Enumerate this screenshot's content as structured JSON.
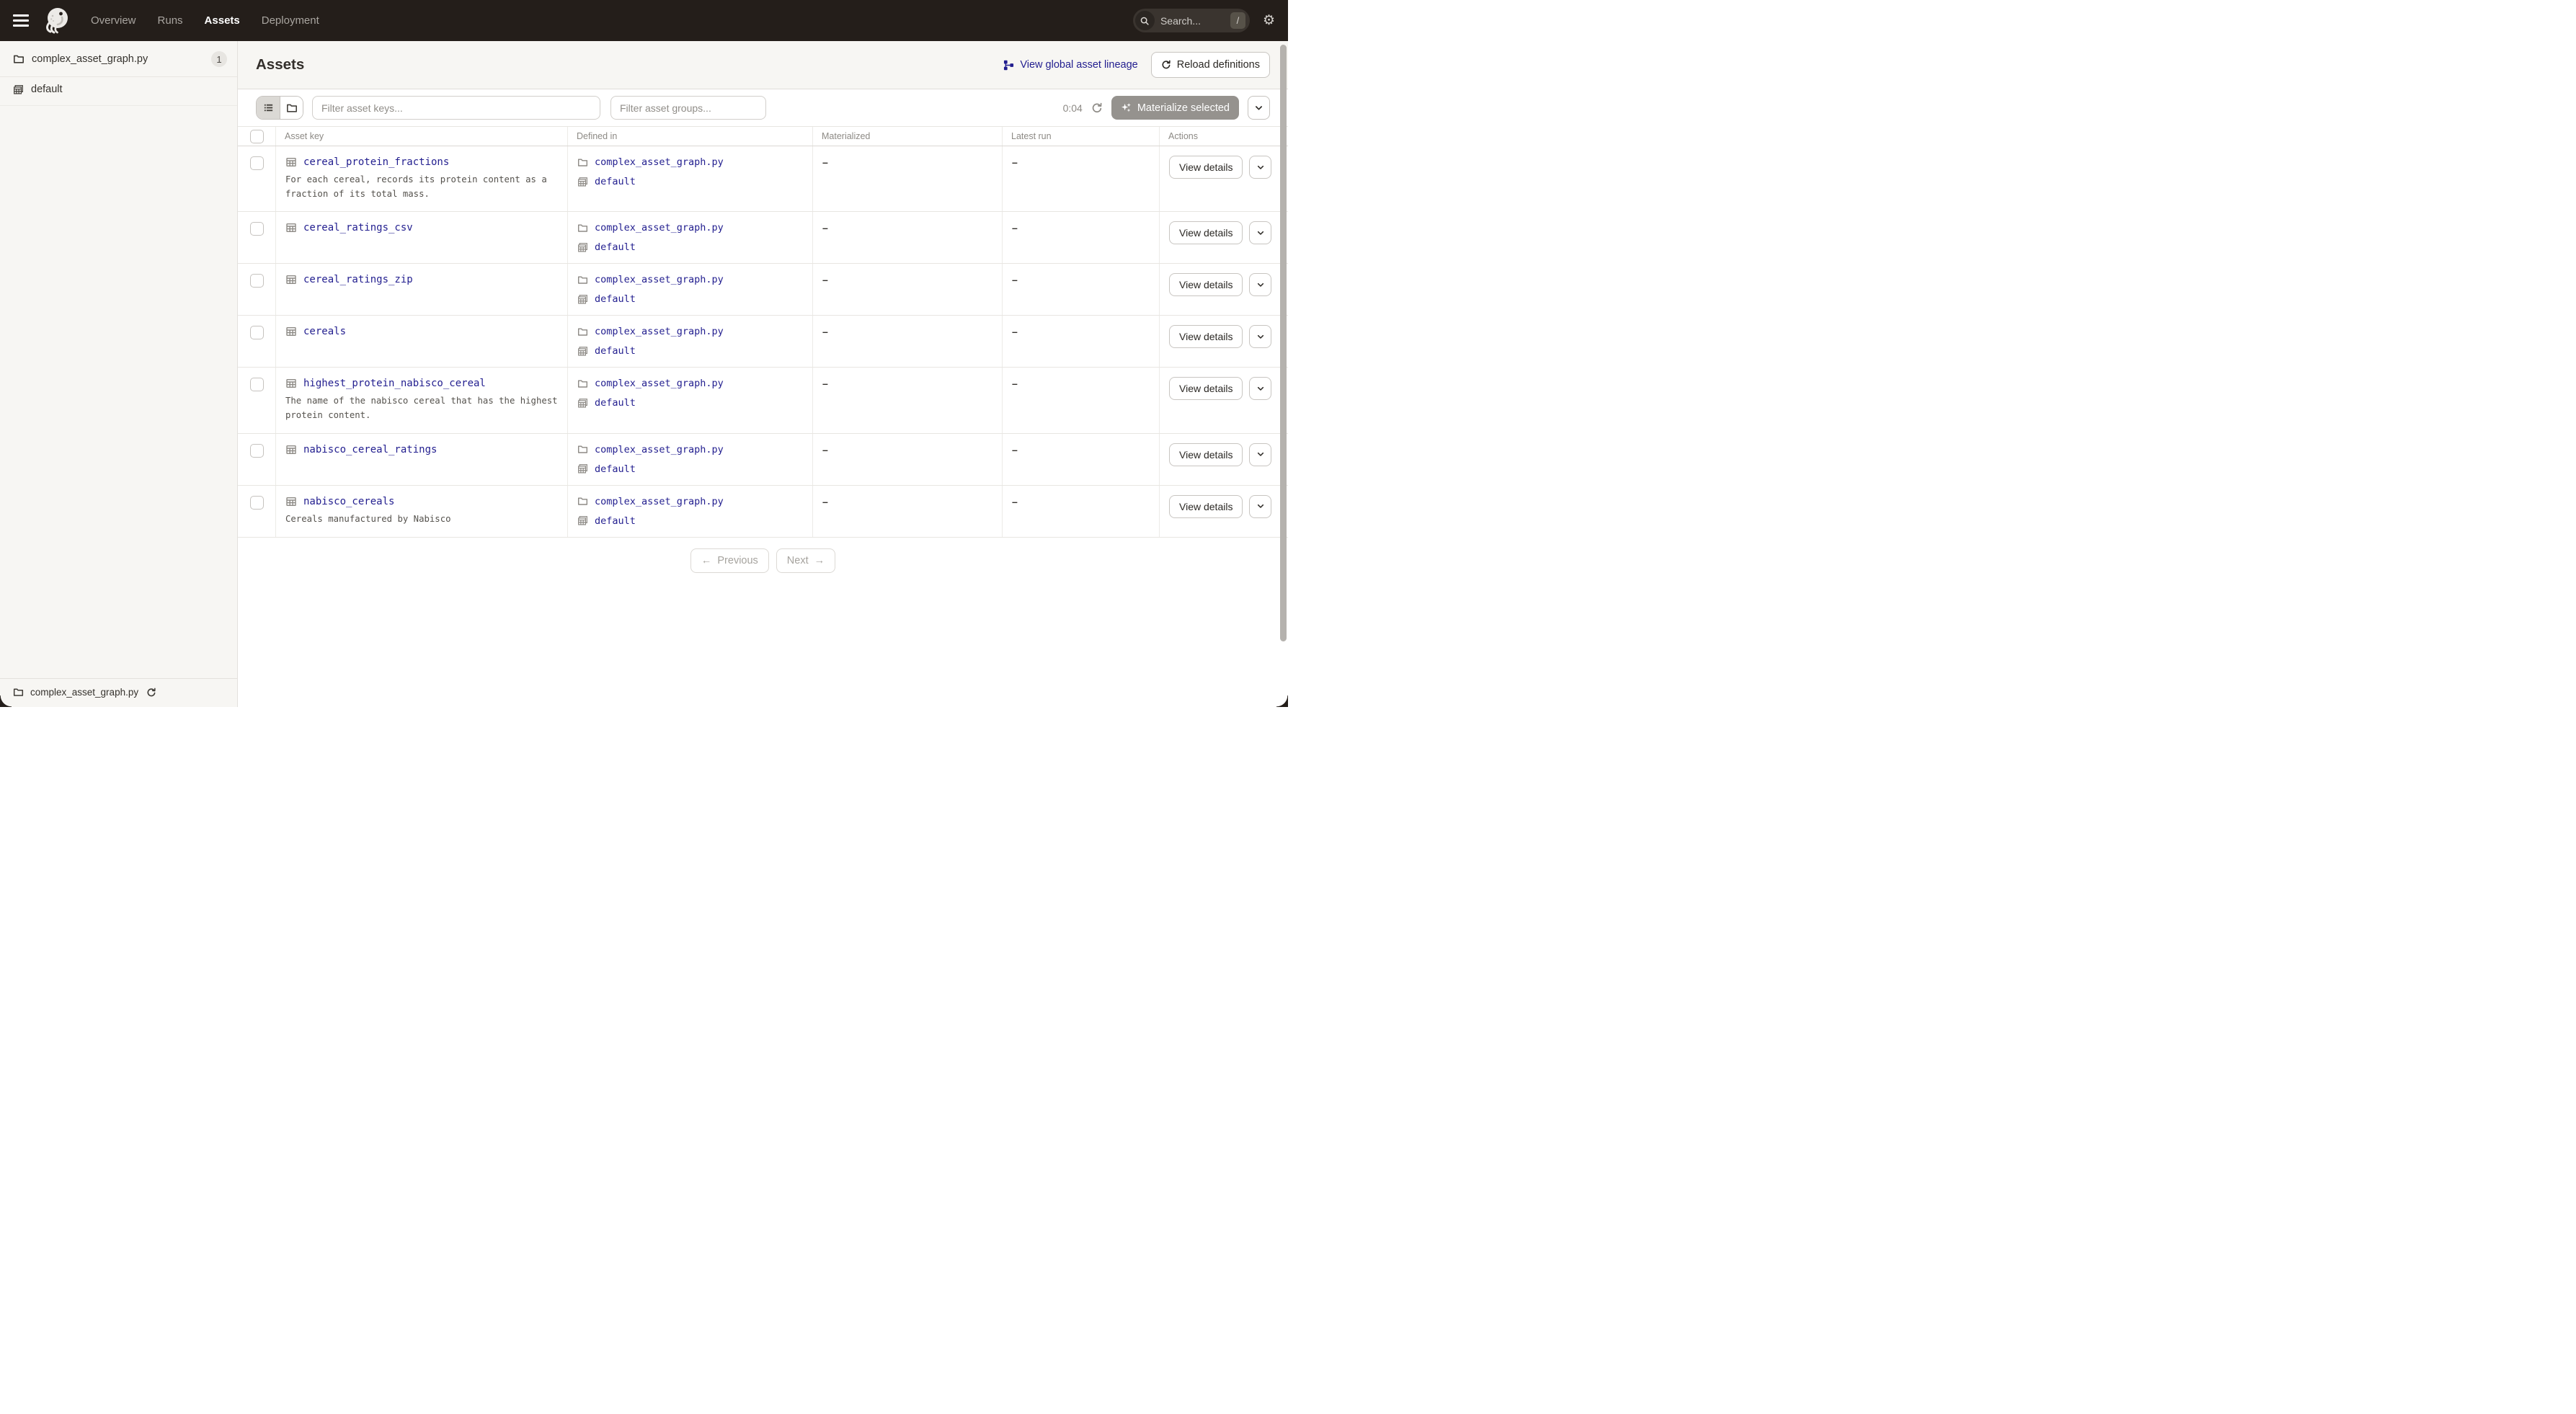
{
  "nav": {
    "menu_items": [
      {
        "label": "Overview"
      },
      {
        "label": "Runs"
      },
      {
        "label": "Assets"
      },
      {
        "label": "Deployment"
      }
    ],
    "active_item": "Assets",
    "search_placeholder": "Search...",
    "search_shortcut": "/",
    "gear_glyph": "⚙"
  },
  "sidebar": {
    "repo": {
      "label": "complex_asset_graph.py",
      "badge": "1"
    },
    "groups": [
      {
        "label": "default"
      }
    ],
    "footer": {
      "label": "complex_asset_graph.py"
    }
  },
  "page": {
    "title": "Assets",
    "lineage_link_label": "View global asset lineage",
    "reload_button_label": "Reload definitions"
  },
  "toolbar": {
    "filter_keys_placeholder": "Filter asset keys...",
    "filter_groups_placeholder": "Filter asset groups...",
    "refresh_timer": "0:04",
    "materialize_button_label": "Materialize selected"
  },
  "table": {
    "columns": [
      "Asset key",
      "Defined in",
      "Materialized",
      "Latest run",
      "Actions"
    ],
    "view_details_label": "View details",
    "rows": [
      {
        "key": "cereal_protein_fractions",
        "description": "For each cereal, records its protein content as a fraction of its total mass.",
        "defined_in_file": "complex_asset_graph.py",
        "defined_in_group": "default",
        "materialized": "–",
        "latest_run": "–"
      },
      {
        "key": "cereal_ratings_csv",
        "defined_in_file": "complex_asset_graph.py",
        "defined_in_group": "default",
        "materialized": "–",
        "latest_run": "–"
      },
      {
        "key": "cereal_ratings_zip",
        "defined_in_file": "complex_asset_graph.py",
        "defined_in_group": "default",
        "materialized": "–",
        "latest_run": "–"
      },
      {
        "key": "cereals",
        "defined_in_file": "complex_asset_graph.py",
        "defined_in_group": "default",
        "materialized": "–",
        "latest_run": "–"
      },
      {
        "key": "highest_protein_nabisco_cereal",
        "description": "The name of the nabisco cereal that has the highest protein content.",
        "defined_in_file": "complex_asset_graph.py",
        "defined_in_group": "default",
        "materialized": "–",
        "latest_run": "–"
      },
      {
        "key": "nabisco_cereal_ratings",
        "defined_in_file": "complex_asset_graph.py",
        "defined_in_group": "default",
        "materialized": "–",
        "latest_run": "–"
      },
      {
        "key": "nabisco_cereals",
        "description": "Cereals manufactured by Nabisco",
        "defined_in_file": "complex_asset_graph.py",
        "defined_in_group": "default",
        "materialized": "–",
        "latest_run": "–"
      }
    ]
  },
  "pagination": {
    "previous_label": "Previous",
    "next_label": "Next",
    "prev_arrow": "←",
    "next_arrow": "→"
  },
  "colors": {
    "nav_bg": "#241e1a",
    "link": "#221e8f",
    "page_bg": "#f7f6f3",
    "disabled_button_bg": "#95928e"
  }
}
